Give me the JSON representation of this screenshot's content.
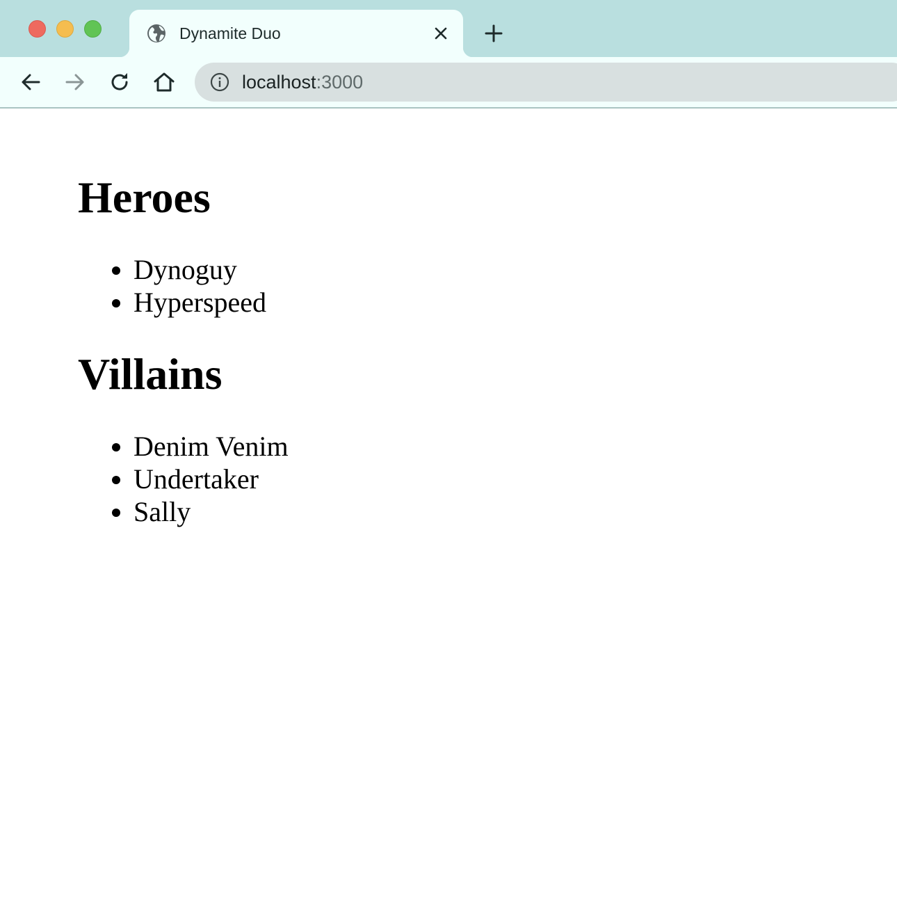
{
  "browser": {
    "tab": {
      "title": "Dynamite Duo",
      "favicon_icon": "globe-icon",
      "close_icon": "close-icon"
    },
    "new_tab_icon": "plus-icon",
    "toolbar": {
      "back_icon": "arrow-left-icon",
      "forward_icon": "arrow-right-icon",
      "reload_icon": "reload-icon",
      "home_icon": "home-icon"
    },
    "address_bar": {
      "info_icon": "info-icon",
      "host": "localhost",
      "port": ":3000"
    },
    "colors": {
      "tab_strip": "#b9dfdf",
      "active_tab": "#f2fffd",
      "omnibox": "#d8e0e0",
      "close_dot": "#ee6a5f",
      "minimize_dot": "#f5bd4f",
      "zoom_dot": "#61c455"
    }
  },
  "page": {
    "heroes": {
      "heading": "Heroes",
      "items": [
        "Dynoguy",
        "Hyperspeed"
      ]
    },
    "villains": {
      "heading": "Villains",
      "items": [
        "Denim Venim",
        "Undertaker",
        "Sally"
      ]
    }
  }
}
